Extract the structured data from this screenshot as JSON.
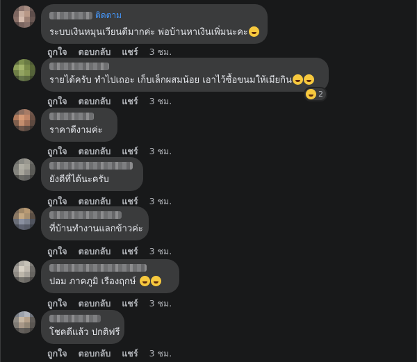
{
  "comments": [
    {
      "name_link": "ติดตาม",
      "text": "ระบบเงินหมุนเวียนดีมากค่ะ พ่อบ้านหาเงินเพิ่มนะคะ",
      "emoji": "laughing-emoji",
      "like": "ถูกใจ",
      "reply": "ตอบกลับ",
      "share": "แชร์",
      "time": "3 ชม."
    },
    {
      "text": "รายได้ครับ ทำไปเถอะ เก็บเล็กผสมน้อย เอาไว้ซื้อขนมให้เมียกิน",
      "reaction_count": "2",
      "like": "ถูกใจ",
      "reply": "ตอบกลับ",
      "share": "แชร์",
      "time": "3 ชม."
    },
    {
      "text": "ราคาดีงามค่ะ",
      "like": "ถูกใจ",
      "reply": "ตอบกลับ",
      "share": "แชร์",
      "time": "3 ชม."
    },
    {
      "text": "ยังดีที่ได้นะครับ",
      "like": "ถูกใจ",
      "reply": "ตอบกลับ",
      "share": "แชร์",
      "time": "3 ชม."
    },
    {
      "text": "ที่บ้านทำงานแลกข้าวค่ะ",
      "like": "ถูกใจ",
      "reply": "ตอบกลับ",
      "share": "แชร์",
      "time": "3 ชม."
    },
    {
      "text": "ปอม ภาคภูมิ เรืองฤกษ์",
      "like": "ถูกใจ",
      "reply": "ตอบกลับ",
      "share": "แชร์",
      "time": "3 ชม."
    },
    {
      "text": "โชคดีแล้ว ปกติฟรี",
      "like": "ถูกใจ",
      "reply": "ตอบกลับ",
      "share": "แชร์",
      "time": "3 ชม."
    }
  ]
}
